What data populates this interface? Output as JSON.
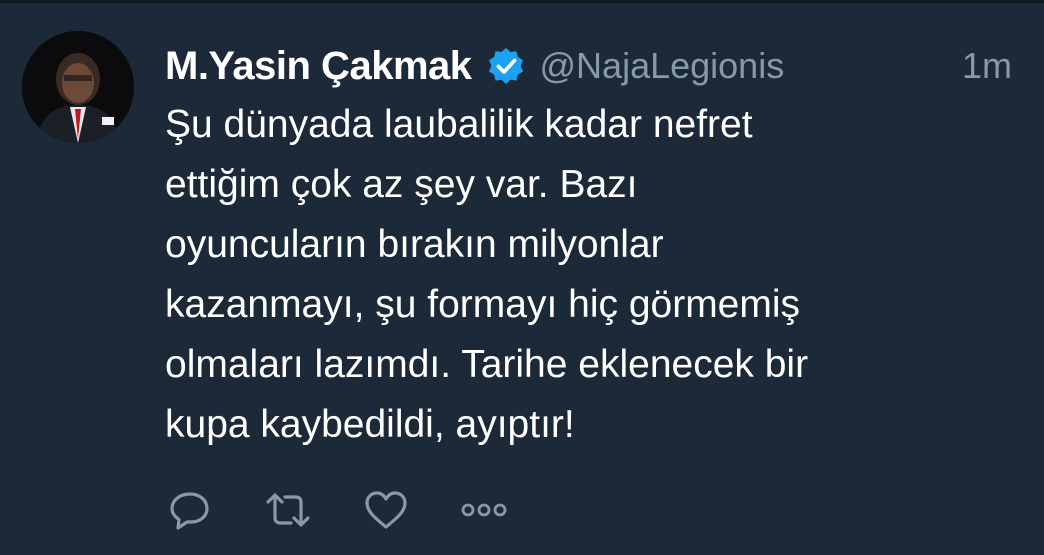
{
  "tweet": {
    "display_name": "M.Yasin Çakmak",
    "handle": "@NajaLegionis",
    "time": "1m",
    "verified": true,
    "text_lines": [
      "Şu dünyada laubalilik kadar nefret",
      "ettiğim çok az şey var. Bazı",
      "oyuncuların bırakın milyonlar",
      "kazanmayı, şu formayı hiç görmemiş",
      "olmaları lazımdı. Tarihe eklenecek bir",
      "kupa kaybedildi, ayıptır!"
    ]
  },
  "actions": [
    {
      "icon": "reply-icon"
    },
    {
      "icon": "retweet-icon"
    },
    {
      "icon": "like-icon"
    },
    {
      "icon": "more-icon"
    }
  ],
  "colors": {
    "background": "#1c2938",
    "text": "#ffffff",
    "secondary": "#8899a6",
    "verified_badge": "#1da1f2"
  }
}
